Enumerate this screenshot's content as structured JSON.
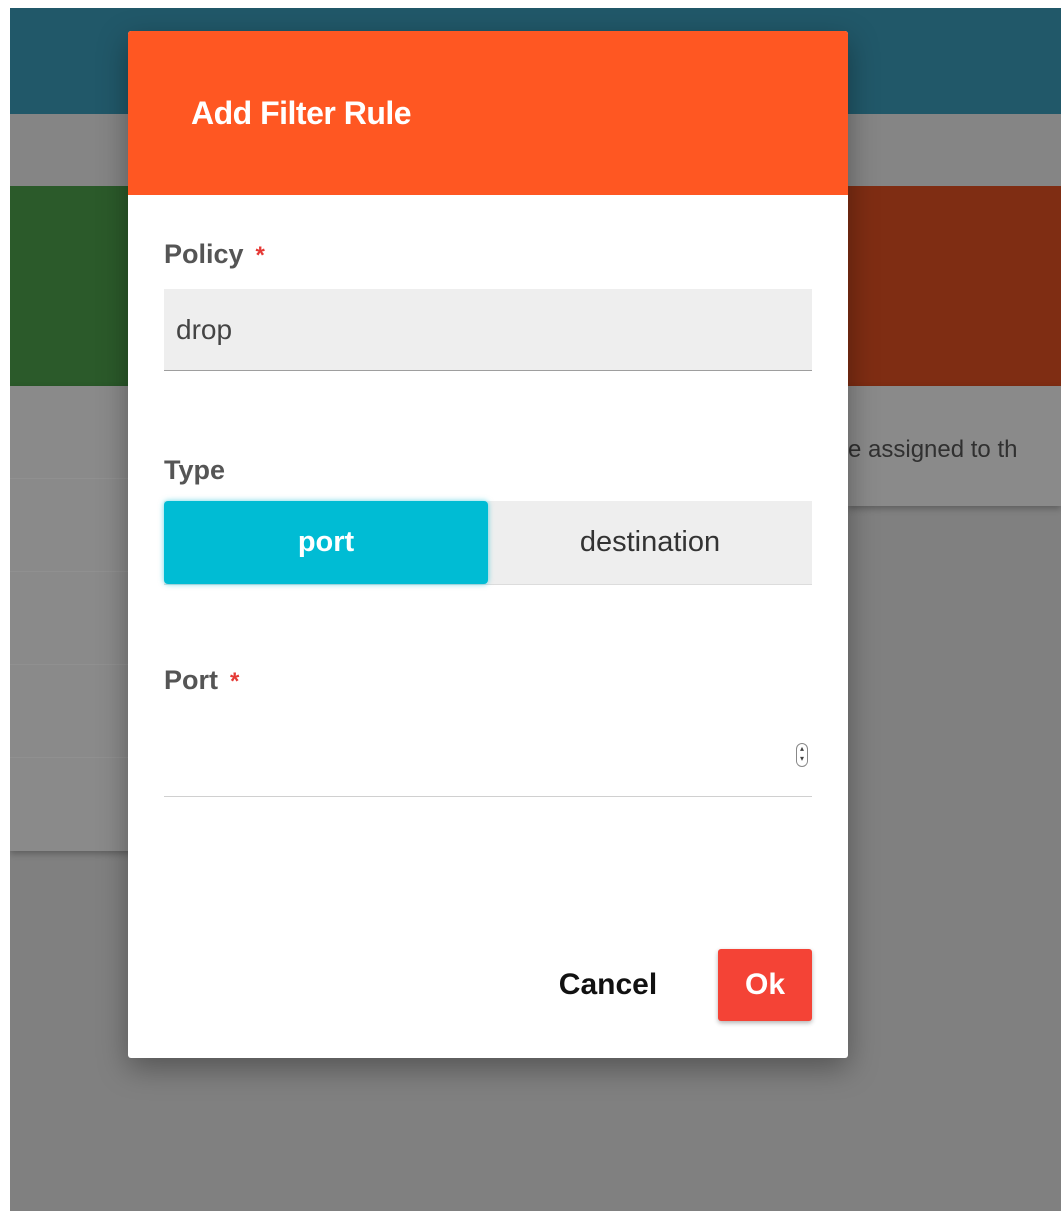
{
  "background": {
    "notice_text": "e assigned to th",
    "colors": {
      "topbar": "#215869",
      "green_card": "#2b5a2a",
      "orange_card": "#7f2d13",
      "overlay": "#808080"
    }
  },
  "dialog": {
    "title": "Add Filter Rule",
    "header_color": "#ff5722",
    "policy": {
      "label": "Policy",
      "required_mark": "*",
      "value": "drop"
    },
    "type": {
      "label": "Type",
      "options": [
        "port",
        "destination"
      ],
      "selected": "port",
      "active_color": "#00bcd4"
    },
    "port": {
      "label": "Port",
      "required_mark": "*",
      "value": ""
    },
    "actions": {
      "cancel_label": "Cancel",
      "ok_label": "Ok",
      "ok_color": "#f44336"
    }
  }
}
